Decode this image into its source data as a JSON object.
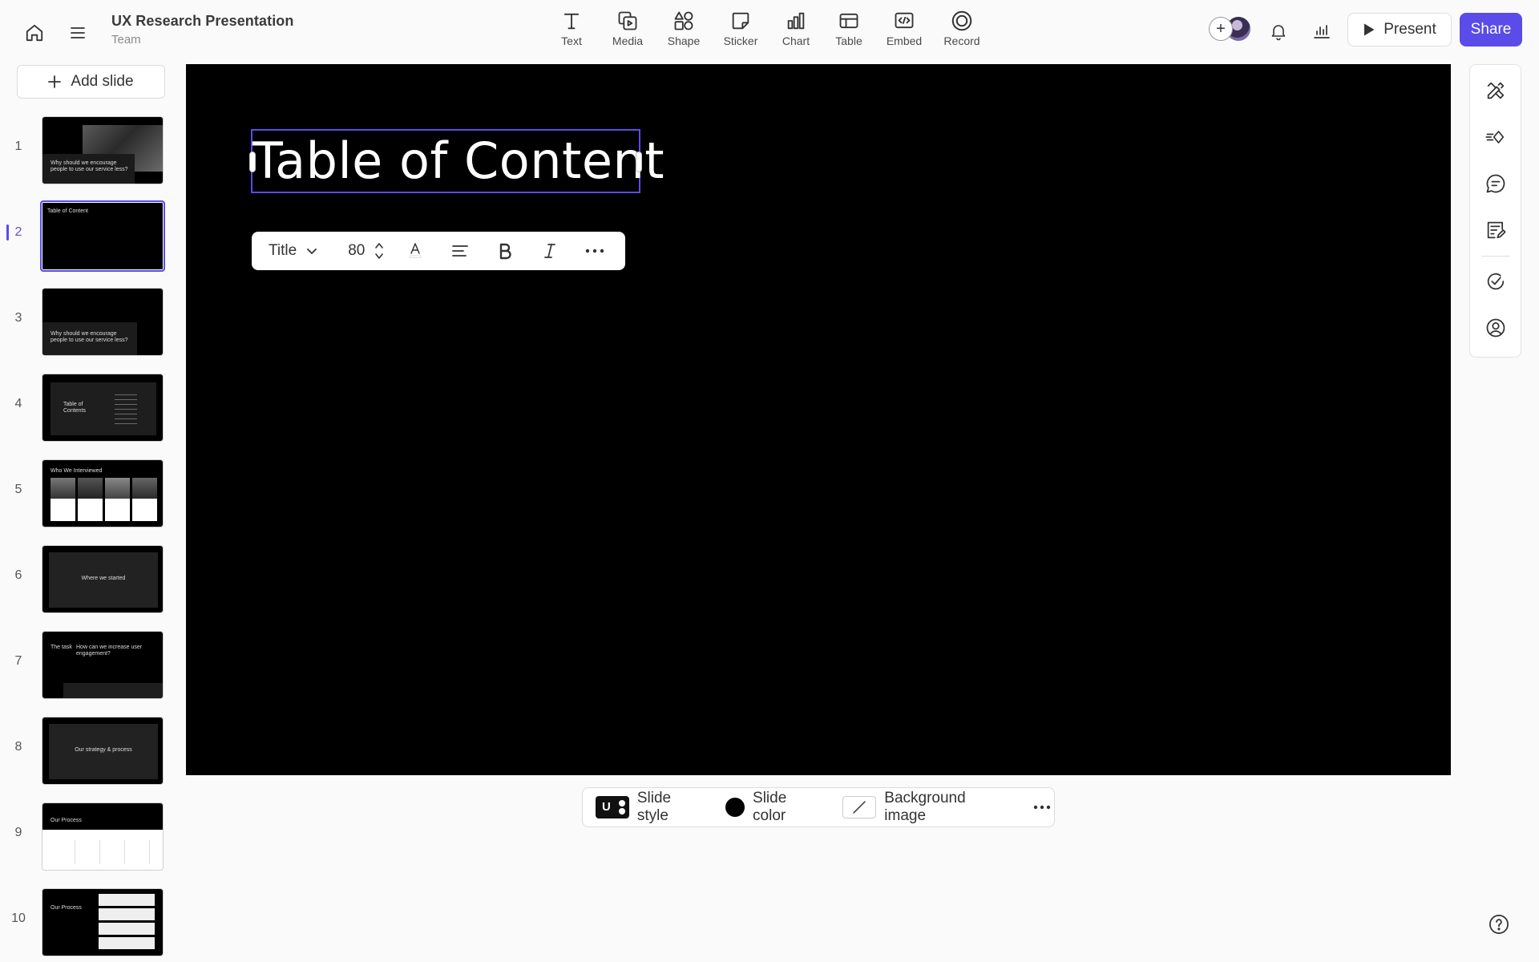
{
  "app": {
    "title": "UX Research Presentation",
    "workspace": "Team",
    "accent": "#5b4be8"
  },
  "toolbar": {
    "tools": [
      {
        "label": "Text",
        "icon": "text-icon"
      },
      {
        "label": "Media",
        "icon": "media-icon"
      },
      {
        "label": "Shape",
        "icon": "shape-icon"
      },
      {
        "label": "Sticker",
        "icon": "sticker-icon"
      },
      {
        "label": "Chart",
        "icon": "chart-icon"
      },
      {
        "label": "Table",
        "icon": "table-icon"
      },
      {
        "label": "Embed",
        "icon": "embed-icon"
      },
      {
        "label": "Record",
        "icon": "record-icon"
      }
    ],
    "present_label": "Present",
    "share_label": "Share"
  },
  "sidebar": {
    "add_slide_label": "Add slide",
    "active_slide": 2,
    "slides": [
      {
        "number": "1",
        "lines": [
          "Why should we encourage",
          "people to use our service less?"
        ]
      },
      {
        "number": "2",
        "lines": [
          "Table of Content"
        ]
      },
      {
        "number": "3",
        "lines": [
          "Why should we encourage",
          "people to use our service less?"
        ]
      },
      {
        "number": "4",
        "lines": [
          "Table of",
          "Contents"
        ]
      },
      {
        "number": "5",
        "lines": [
          "Who We Interviewed"
        ]
      },
      {
        "number": "6",
        "lines": [
          "Where we started"
        ]
      },
      {
        "number": "7",
        "lines": [
          "The task",
          "How can we increase user engagement?"
        ]
      },
      {
        "number": "8",
        "lines": [
          "Our strategy & process"
        ]
      },
      {
        "number": "9",
        "lines": [
          "Our Process"
        ]
      },
      {
        "number": "10",
        "lines": [
          "Our Process"
        ]
      }
    ]
  },
  "canvas": {
    "background": "#000000",
    "title_text": "Table of Content"
  },
  "text_toolbar": {
    "style_label": "Title",
    "font_size": "80"
  },
  "style_bar": {
    "slide_style_label": "Slide style",
    "logo_letter": "U",
    "slide_color_label": "Slide color",
    "slide_color": "#000000",
    "background_image_label": "Background image"
  }
}
